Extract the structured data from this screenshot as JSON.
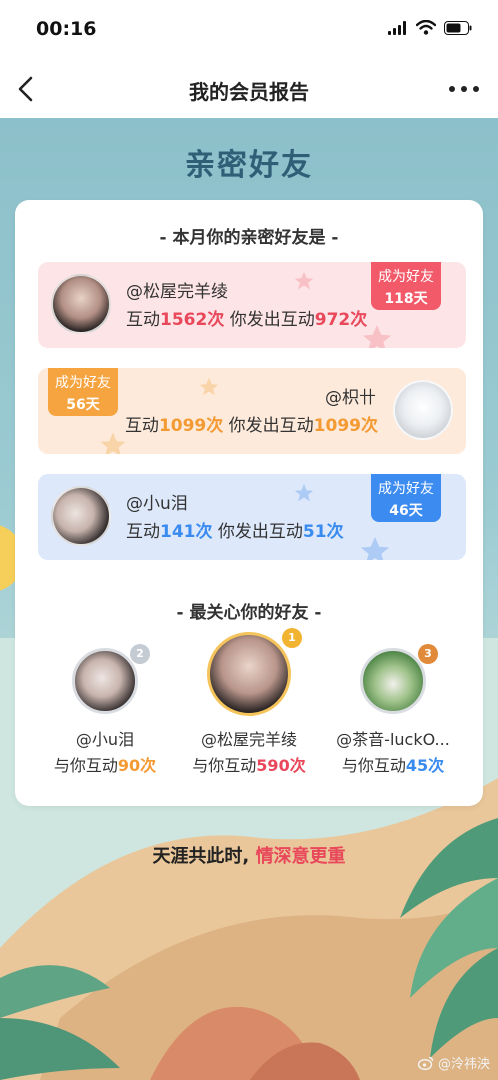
{
  "status_bar": {
    "time": "00:16"
  },
  "nav": {
    "title": "我的会员报告"
  },
  "page": {
    "title": "亲密好友"
  },
  "intimate_section": {
    "title": "- 本月你的亲密好友是 -",
    "friends": [
      {
        "name": "@松屋完羊绫",
        "interact_label": "互动",
        "interact_count": "1562",
        "times_unit": "次",
        "sent_label": "你发出互动",
        "sent_count": "972",
        "badge_label": "成为好友",
        "badge_days": "118天",
        "color": "#e8485a"
      },
      {
        "name": "@枳卄",
        "interact_label": "互动",
        "interact_count": "1099",
        "times_unit": "次",
        "sent_label": "你发出互动",
        "sent_count": "1099",
        "badge_label": "成为好友",
        "badge_days": "56天",
        "color": "#f49a33"
      },
      {
        "name": "@小u泪",
        "interact_label": "互动",
        "interact_count": "141",
        "times_unit": "次",
        "sent_label": "你发出互动",
        "sent_count": "51",
        "badge_label": "成为好友",
        "badge_days": "46天",
        "color": "#3a8bef"
      }
    ]
  },
  "caring_section": {
    "title": "- 最关心你的好友 -",
    "friends": [
      {
        "rank": "2",
        "name": "@小u泪",
        "label": "与你互动",
        "count": "90",
        "unit": "次"
      },
      {
        "rank": "1",
        "name": "@松屋完羊绫",
        "label": "与你互动",
        "count": "590",
        "unit": "次"
      },
      {
        "rank": "3",
        "name": "@茶音-luckO...",
        "label": "与你互动",
        "count": "45",
        "unit": "次"
      }
    ]
  },
  "slogan": {
    "part1": "天涯共此时,",
    "part2": "情深意更重"
  },
  "watermark": {
    "text": "@泠祎泱"
  },
  "colors": {
    "accent_red": "#e8485a",
    "accent_orange": "#f49a33",
    "accent_blue": "#3a8bef",
    "title_blue": "#2f5f77"
  }
}
